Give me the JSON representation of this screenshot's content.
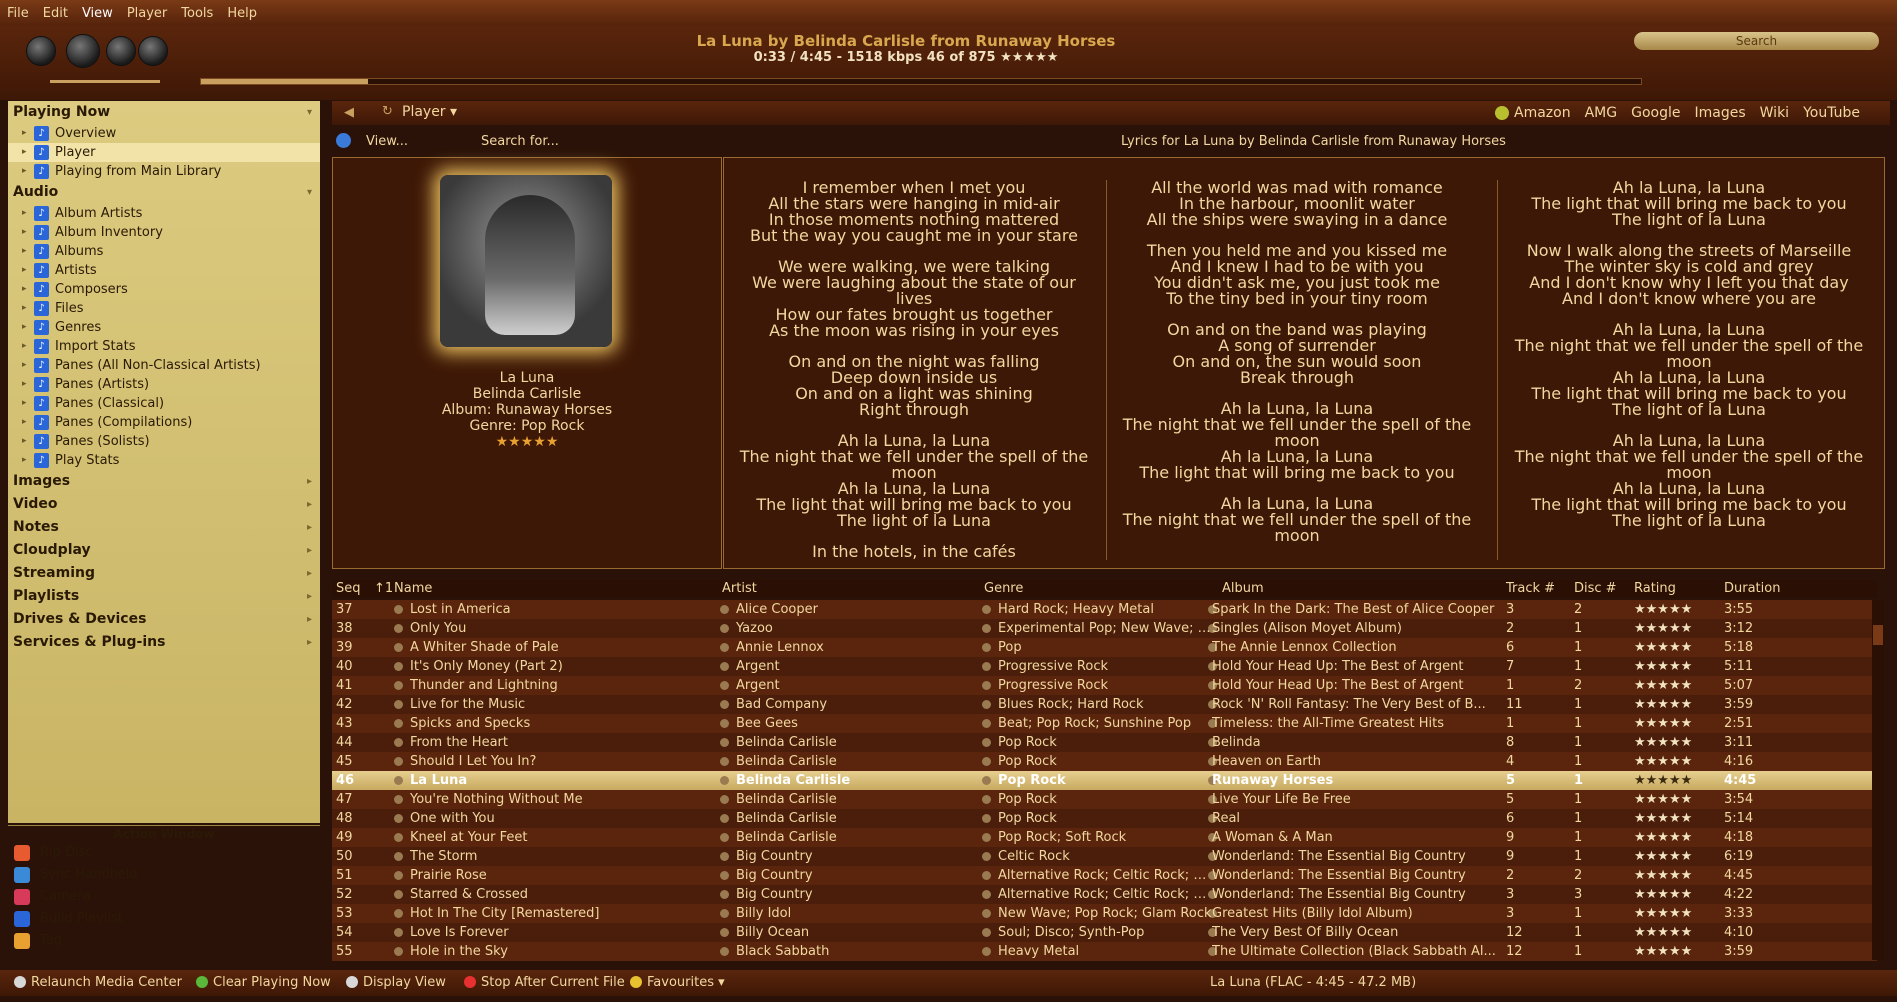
{
  "menu": [
    "File",
    "Edit",
    "View",
    "Player",
    "Tools",
    "Help"
  ],
  "active_menu": "View",
  "now_playing": {
    "title": "La Luna by Belinda Carlisle from Runaway Horses",
    "info": "0:33 / 4:45 - 1518 kbps  46 of 875 ★★★★★",
    "progress": 0.116
  },
  "search_placeholder": "Search",
  "sidebar": {
    "groups": [
      {
        "label": "Playing Now",
        "items": [
          {
            "label": "Overview"
          },
          {
            "label": "Player",
            "selected": true
          },
          {
            "label": "Playing from Main Library"
          }
        ]
      },
      {
        "label": "Audio",
        "items": [
          {
            "label": "Album Artists"
          },
          {
            "label": "Album Inventory"
          },
          {
            "label": "Albums"
          },
          {
            "label": "Artists"
          },
          {
            "label": "Composers"
          },
          {
            "label": "Files"
          },
          {
            "label": "Genres"
          },
          {
            "label": "Import Stats"
          },
          {
            "label": "Panes (All Non-Classical Artists)"
          },
          {
            "label": "Panes (Artists)"
          },
          {
            "label": "Panes (Classical)"
          },
          {
            "label": "Panes (Compilations)"
          },
          {
            "label": "Panes (Solists)"
          },
          {
            "label": "Play Stats"
          }
        ]
      },
      {
        "label": "Images",
        "items": []
      },
      {
        "label": "Video",
        "items": []
      },
      {
        "label": "Notes",
        "items": []
      },
      {
        "label": "Cloudplay",
        "items": []
      },
      {
        "label": "Streaming",
        "items": []
      },
      {
        "label": "Playlists",
        "items": []
      },
      {
        "label": "Drives & Devices",
        "items": []
      },
      {
        "label": "Services & Plug-ins",
        "items": []
      }
    ]
  },
  "action_window": {
    "title": "Action Window",
    "items": [
      {
        "label": "Rip Disc",
        "color": "#e85a30"
      },
      {
        "label": "Sync Handheld",
        "color": "#3a8ad8"
      },
      {
        "label": "Camera",
        "color": "#d83a5a"
      },
      {
        "label": "Build Playlist",
        "color": "#2a66d8"
      },
      {
        "label": "Tag",
        "color": "#e8a030"
      }
    ]
  },
  "tab": {
    "label": "Player ▾"
  },
  "web_links": [
    "Amazon",
    "AMG",
    "Google",
    "Images",
    "Wiki",
    "YouTube"
  ],
  "subbar": {
    "view": "View...",
    "search": "Search for..."
  },
  "lyrics_title": "Lyrics for La Luna by Belinda Carlisle from Runaway Horses",
  "album_info": {
    "title": "La Luna",
    "artist": "Belinda Carlisle",
    "album": "Album: Runaway Horses",
    "genre": "Genre: Pop Rock",
    "stars": "★★★★★"
  },
  "lyrics": [
    [
      "I remember when I met you",
      "All the stars were hanging in mid-air",
      "In those moments nothing mattered",
      "But the way you caught me in your stare",
      "",
      "We were walking, we were talking",
      "We were laughing about the state of our lives",
      "How our fates brought us together",
      "As the moon was rising in your eyes",
      "",
      "On and on the night was falling",
      "Deep down inside us",
      "On and on a light was shining",
      "Right through",
      "",
      "Ah la Luna, la Luna",
      "The night that we fell under the spell of the",
      "moon",
      "Ah la Luna, la Luna",
      "The light that will bring me back to you",
      "The light of la Luna",
      "",
      "In the hotels, in the cafés"
    ],
    [
      "All the world was mad with romance",
      "In the harbour, moonlit water",
      "All the ships were swaying in a dance",
      "",
      "Then you held me and you kissed me",
      "And I knew I had to be with you",
      "You didn't ask me, you just took me",
      "To the tiny bed in your tiny room",
      "",
      "On and on the band was playing",
      "A song of surrender",
      "On and on, the sun would soon",
      "Break through",
      "",
      "Ah la Luna, la Luna",
      "The night that we fell under the spell of the",
      "moon",
      "Ah la Luna, la Luna",
      "The light that will bring me back to you",
      "",
      "Ah la Luna, la Luna",
      "The night that we fell under the spell of the",
      "moon"
    ],
    [
      "Ah la Luna, la Luna",
      "The light that will bring me back to you",
      "The light of la Luna",
      "",
      "Now I walk along the streets of Marseille",
      "The winter sky is cold and grey",
      "And I don't know why I left you that day",
      "And I don't know where you are",
      "",
      "Ah la Luna, la Luna",
      "The night that we fell under the spell of the",
      "moon",
      "Ah la Luna, la Luna",
      "The light that will bring me back to you",
      "The light of la Luna",
      "",
      "Ah la Luna, la Luna",
      "The night that we fell under the spell of the",
      "moon",
      "Ah la Luna, la Luna",
      "The light that will bring me back to you",
      "The light of la Luna"
    ]
  ],
  "table": {
    "headers": [
      "Seq",
      "↑1",
      "Name",
      "Artist",
      "Genre",
      "Album",
      "Track #",
      "Disc #",
      "Rating",
      "Duration"
    ],
    "rows": [
      [
        "37",
        "Lost in America",
        "Alice Cooper",
        "Hard Rock; Heavy Metal",
        "Spark In the Dark: The Best of Alice Cooper",
        "3",
        "2",
        "3:55"
      ],
      [
        "38",
        "Only You",
        "Yazoo",
        "Experimental Pop; New Wave; S...",
        "Singles (Alison Moyet Album)",
        "2",
        "1",
        "3:12"
      ],
      [
        "39",
        "A Whiter Shade of Pale",
        "Annie Lennox",
        "Pop",
        "The Annie Lennox Collection",
        "6",
        "1",
        "5:18"
      ],
      [
        "40",
        "It's Only Money (Part 2)",
        "Argent",
        "Progressive Rock",
        "Hold Your Head Up: The Best of Argent",
        "7",
        "1",
        "5:11"
      ],
      [
        "41",
        "Thunder and Lightning",
        "Argent",
        "Progressive Rock",
        "Hold Your Head Up: The Best of Argent",
        "1",
        "2",
        "5:07"
      ],
      [
        "42",
        "Live for the Music",
        "Bad Company",
        "Blues Rock; Hard Rock",
        "Rock 'N' Roll Fantasy: The Very Best of B...",
        "11",
        "1",
        "3:59"
      ],
      [
        "43",
        "Spicks and Specks",
        "Bee Gees",
        "Beat; Pop Rock; Sunshine Pop",
        "Timeless: the All-Time Greatest Hits",
        "1",
        "1",
        "2:51"
      ],
      [
        "44",
        "From the Heart",
        "Belinda Carlisle",
        "Pop Rock",
        "Belinda",
        "8",
        "1",
        "3:11"
      ],
      [
        "45",
        "Should I Let You In?",
        "Belinda Carlisle",
        "Pop Rock",
        "Heaven on Earth",
        "4",
        "1",
        "4:16"
      ],
      [
        "46",
        "La Luna",
        "Belinda Carlisle",
        "Pop Rock",
        "Runaway Horses",
        "5",
        "1",
        "4:45"
      ],
      [
        "47",
        "You're Nothing Without Me",
        "Belinda Carlisle",
        "Pop Rock",
        "Live Your Life Be Free",
        "5",
        "1",
        "3:54"
      ],
      [
        "48",
        "One with You",
        "Belinda Carlisle",
        "Pop Rock",
        "Real",
        "6",
        "1",
        "5:14"
      ],
      [
        "49",
        "Kneel at Your Feet",
        "Belinda Carlisle",
        "Pop Rock; Soft Rock",
        "A Woman & A Man",
        "9",
        "1",
        "4:18"
      ],
      [
        "50",
        "The Storm",
        "Big Country",
        "Celtic Rock",
        "Wonderland: The Essential Big Country",
        "9",
        "1",
        "6:19"
      ],
      [
        "51",
        "Prairie Rose",
        "Big Country",
        "Alternative Rock; Celtic Rock; N...",
        "Wonderland: The Essential Big Country",
        "2",
        "2",
        "4:45"
      ],
      [
        "52",
        "Starred & Crossed",
        "Big Country",
        "Alternative Rock; Celtic Rock; N...",
        "Wonderland: The Essential Big Country",
        "3",
        "3",
        "4:22"
      ],
      [
        "53",
        "Hot In The City [Remastered]",
        "Billy Idol",
        "New Wave; Pop Rock; Glam Rock",
        "Greatest Hits (Billy Idol Album)",
        "3",
        "1",
        "3:33"
      ],
      [
        "54",
        "Love Is Forever",
        "Billy Ocean",
        "Soul; Disco; Synth-Pop",
        "The Very Best Of Billy Ocean",
        "12",
        "1",
        "4:10"
      ],
      [
        "55",
        "Hole in the Sky",
        "Black Sabbath",
        "Heavy Metal",
        "The Ultimate Collection (Black Sabbath Al...",
        "12",
        "1",
        "3:59"
      ]
    ],
    "rating_stars": "★★★★★",
    "current_seq": "46"
  },
  "status": {
    "buttons": [
      {
        "label": "Relaunch Media Center",
        "color": "#d8d8d8"
      },
      {
        "label": "Clear Playing Now",
        "color": "#5ab83a"
      },
      {
        "label": "Display View",
        "color": "#d8d8d8"
      },
      {
        "label": "Stop After Current File",
        "color": "#e83030"
      },
      {
        "label": "Favourites ▾",
        "color": "#e8c030"
      }
    ],
    "info": "La Luna (FLAC - 4:45 - 47.2 MB)"
  }
}
